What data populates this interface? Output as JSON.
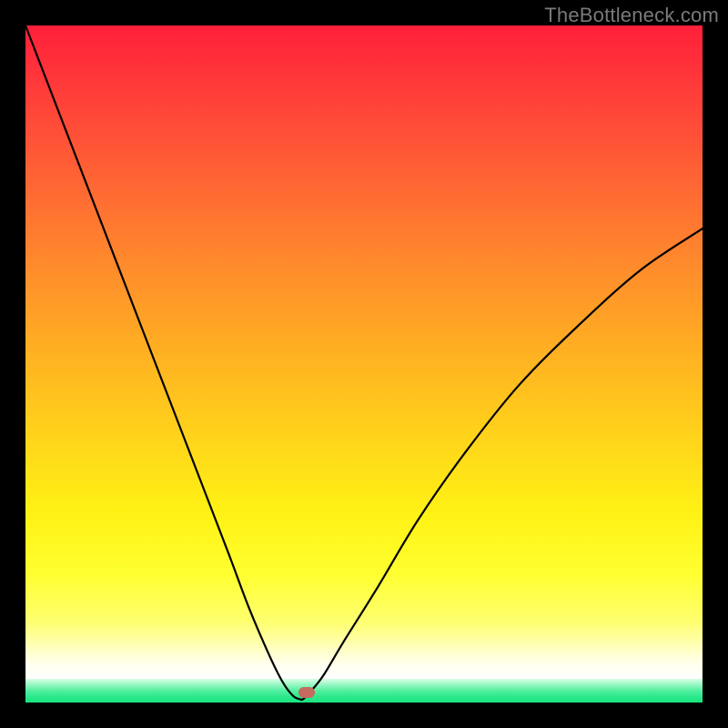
{
  "watermark": "TheBottleneck.com",
  "chart_data": {
    "type": "line",
    "title": "",
    "xlabel": "",
    "ylabel": "",
    "xlim": [
      0,
      100
    ],
    "ylim": [
      0,
      100
    ],
    "series": [
      {
        "name": "bottleneck-curve",
        "x": [
          0,
          5,
          10,
          15,
          20,
          25,
          30,
          33,
          36,
          38,
          39.5,
          40.5,
          41,
          42,
          44,
          47,
          52,
          58,
          65,
          73,
          82,
          91,
          100
        ],
        "y": [
          100,
          87,
          74,
          61,
          48,
          35,
          22,
          14,
          7,
          3,
          1,
          0.5,
          0.5,
          1.5,
          4,
          9,
          17,
          27,
          37,
          47,
          56,
          64,
          70
        ]
      }
    ],
    "annotations": [
      {
        "name": "optimal-marker",
        "x": 41.5,
        "y": 1.5
      }
    ],
    "background_gradient": {
      "top_color": "#ff1f3a",
      "mid_color": "#ffd61a",
      "bottom_color": "#17e57e"
    }
  }
}
